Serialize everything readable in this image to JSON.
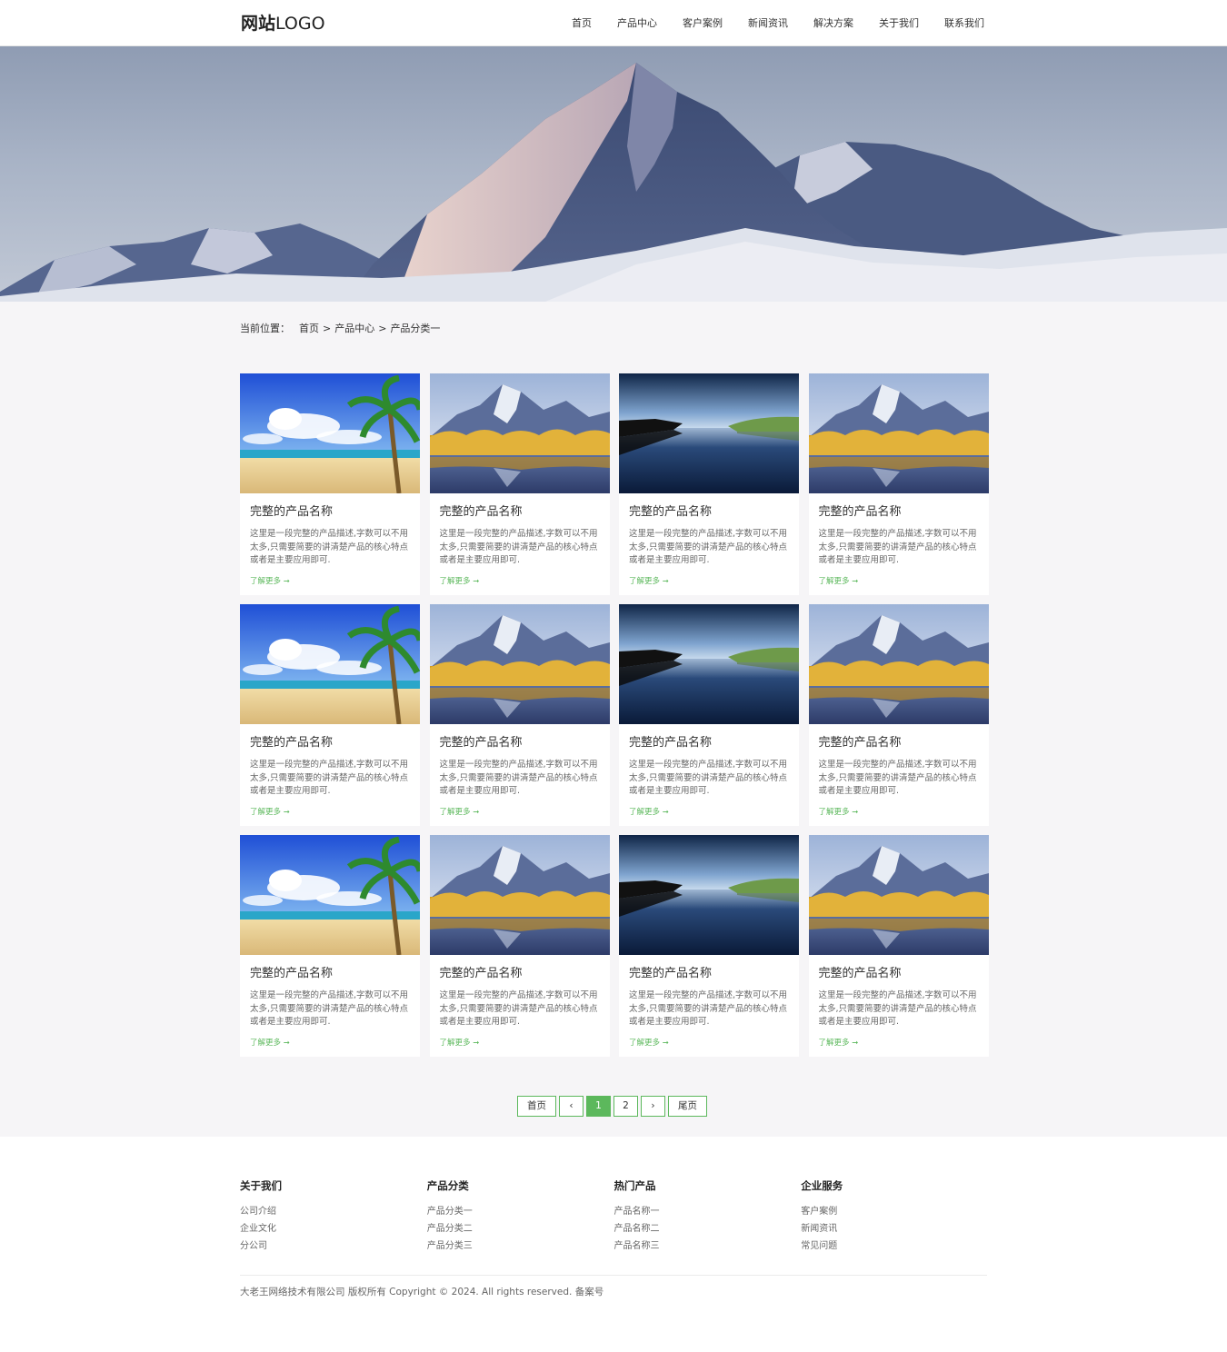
{
  "header": {
    "logo_bold": "网站",
    "logo_rest": "LOGO",
    "nav": [
      "首页",
      "产品中心",
      "客户案例",
      "新闻资讯",
      "解决方案",
      "关于我们",
      "联系我们"
    ]
  },
  "breadcrumb": {
    "label": "当前位置：",
    "items": [
      "首页",
      "产品中心",
      "产品分类一"
    ],
    "separator": ">"
  },
  "products": [
    {
      "image": "beach",
      "title": "完整的产品名称",
      "desc": "这里是一段完整的产品描述,字数可以不用太多,只需要简要的讲清楚产品的核心特点或者是主要应用即可.",
      "more": "了解更多 ➞"
    },
    {
      "image": "mountain-lake",
      "title": "完整的产品名称",
      "desc": "这里是一段完整的产品描述,字数可以不用太多,只需要简要的讲清楚产品的核心特点或者是主要应用即可.",
      "more": "了解更多 ➞"
    },
    {
      "image": "river",
      "title": "完整的产品名称",
      "desc": "这里是一段完整的产品描述,字数可以不用太多,只需要简要的讲清楚产品的核心特点或者是主要应用即可.",
      "more": "了解更多 ➞"
    },
    {
      "image": "mountain-lake",
      "title": "完整的产品名称",
      "desc": "这里是一段完整的产品描述,字数可以不用太多,只需要简要的讲清楚产品的核心特点或者是主要应用即可.",
      "more": "了解更多 ➞"
    },
    {
      "image": "beach",
      "title": "完整的产品名称",
      "desc": "这里是一段完整的产品描述,字数可以不用太多,只需要简要的讲清楚产品的核心特点或者是主要应用即可.",
      "more": "了解更多 ➞"
    },
    {
      "image": "mountain-lake",
      "title": "完整的产品名称",
      "desc": "这里是一段完整的产品描述,字数可以不用太多,只需要简要的讲清楚产品的核心特点或者是主要应用即可.",
      "more": "了解更多 ➞"
    },
    {
      "image": "river",
      "title": "完整的产品名称",
      "desc": "这里是一段完整的产品描述,字数可以不用太多,只需要简要的讲清楚产品的核心特点或者是主要应用即可.",
      "more": "了解更多 ➞"
    },
    {
      "image": "mountain-lake",
      "title": "完整的产品名称",
      "desc": "这里是一段完整的产品描述,字数可以不用太多,只需要简要的讲清楚产品的核心特点或者是主要应用即可.",
      "more": "了解更多 ➞"
    },
    {
      "image": "beach",
      "title": "完整的产品名称",
      "desc": "这里是一段完整的产品描述,字数可以不用太多,只需要简要的讲清楚产品的核心特点或者是主要应用即可.",
      "more": "了解更多 ➞"
    },
    {
      "image": "mountain-lake",
      "title": "完整的产品名称",
      "desc": "这里是一段完整的产品描述,字数可以不用太多,只需要简要的讲清楚产品的核心特点或者是主要应用即可.",
      "more": "了解更多 ➞"
    },
    {
      "image": "river",
      "title": "完整的产品名称",
      "desc": "这里是一段完整的产品描述,字数可以不用太多,只需要简要的讲清楚产品的核心特点或者是主要应用即可.",
      "more": "了解更多 ➞"
    },
    {
      "image": "mountain-lake",
      "title": "完整的产品名称",
      "desc": "这里是一段完整的产品描述,字数可以不用太多,只需要简要的讲清楚产品的核心特点或者是主要应用即可.",
      "more": "了解更多 ➞"
    }
  ],
  "pagination": {
    "first": "首页",
    "prev": "‹",
    "pages": [
      "1",
      "2"
    ],
    "current": "1",
    "next": "›",
    "last": "尾页"
  },
  "footer": {
    "columns": [
      {
        "title": "关于我们",
        "links": [
          "公司介绍",
          "企业文化",
          "分公司"
        ]
      },
      {
        "title": "产品分类",
        "links": [
          "产品分类一",
          "产品分类二",
          "产品分类三"
        ]
      },
      {
        "title": "热门产品",
        "links": [
          "产品名称一",
          "产品名称二",
          "产品名称三"
        ]
      },
      {
        "title": "企业服务",
        "links": [
          "客户案例",
          "新闻资讯",
          "常见问题"
        ]
      }
    ],
    "copyright": "大老王网络技术有限公司 版权所有 Copyright © 2024. All rights reserved. 备案号"
  },
  "colors": {
    "accent": "#5cb85c",
    "page_bg": "#f6f5f7"
  }
}
